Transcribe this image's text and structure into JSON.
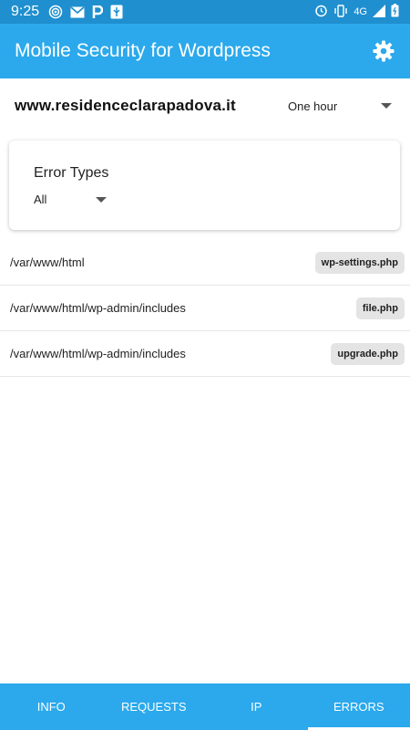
{
  "status_bar": {
    "time": "9:25",
    "network": "4G",
    "left_icons": [
      "podcast-icon",
      "gmail-icon",
      "parking-icon",
      "usb-icon"
    ],
    "right_icons": [
      "alarm-icon",
      "vibrate-icon",
      "signal-icon",
      "battery-icon"
    ]
  },
  "app_bar": {
    "title": "Mobile Security for Wordpress",
    "settings_icon": "gear-icon"
  },
  "site": {
    "name": "www.residenceclarapadova.it",
    "period": "One hour"
  },
  "error_filter": {
    "label": "Error Types",
    "selected": "All"
  },
  "errors": [
    {
      "path": "/var/www/html",
      "file": "wp-settings.php"
    },
    {
      "path": "/var/www/html/wp-admin/includes",
      "file": "file.php"
    },
    {
      "path": "/var/www/html/wp-admin/includes",
      "file": "upgrade.php"
    }
  ],
  "bottom_nav": {
    "tabs": [
      {
        "label": "INFO"
      },
      {
        "label": "REQUESTS"
      },
      {
        "label": "IP"
      },
      {
        "label": "ERRORS"
      }
    ],
    "active": "ERRORS"
  },
  "colors": {
    "primary": "#2ba9ec",
    "status_bar": "#1f8fcf",
    "chip": "#e4e4e4"
  }
}
